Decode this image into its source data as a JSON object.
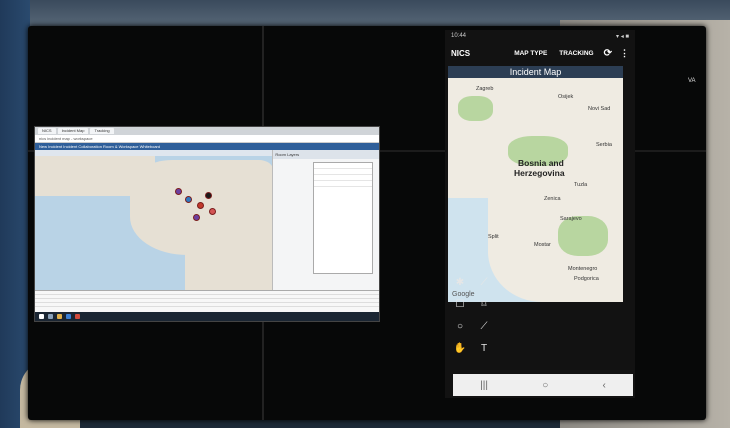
{
  "desktop": {
    "tabs": [
      "NICS",
      "Incident Map",
      "Tracking"
    ],
    "address": "nics incident map - workspace",
    "header_text": "New Incident  Incident Collaboration  Room & Workspace  Whiteboard",
    "side_title": "Room Layers",
    "taskbar_icons": [
      "windows-start",
      "search",
      "file-explorer",
      "browser",
      "app"
    ]
  },
  "tablet": {
    "time": "10:44",
    "status_icons": "▾ ◂ ■",
    "app_title": "NICS",
    "actions": [
      "MAP TYPE",
      "TRACKING"
    ],
    "map_header": "Incident Map",
    "places": [
      {
        "name": "Zagreb",
        "cls": "place"
      },
      {
        "name": "Osijek",
        "cls": "place"
      },
      {
        "name": "Bosnia and",
        "cls": "place big"
      },
      {
        "name": "Herzegovina",
        "cls": "place big"
      },
      {
        "name": "Novi Sad",
        "cls": "place"
      },
      {
        "name": "Split",
        "cls": "place"
      },
      {
        "name": "Mostar",
        "cls": "place"
      },
      {
        "name": "Sarajevo",
        "cls": "place"
      },
      {
        "name": "Zenica",
        "cls": "place"
      },
      {
        "name": "Tuzla",
        "cls": "place"
      },
      {
        "name": "Montenegro",
        "cls": "place"
      },
      {
        "name": "Podgorica",
        "cls": "place"
      },
      {
        "name": "Serbia",
        "cls": "place"
      }
    ],
    "google": "Google",
    "tools": [
      "✱",
      "⟋",
      "☐",
      "⌑",
      "○",
      "⟋",
      "✋",
      "T"
    ],
    "nav": [
      "|||",
      "○",
      "‹"
    ]
  },
  "side_tag": "VA",
  "colors": {
    "accent": "#2c3e54",
    "water": "#cfe3ee",
    "land": "#efebe2"
  }
}
